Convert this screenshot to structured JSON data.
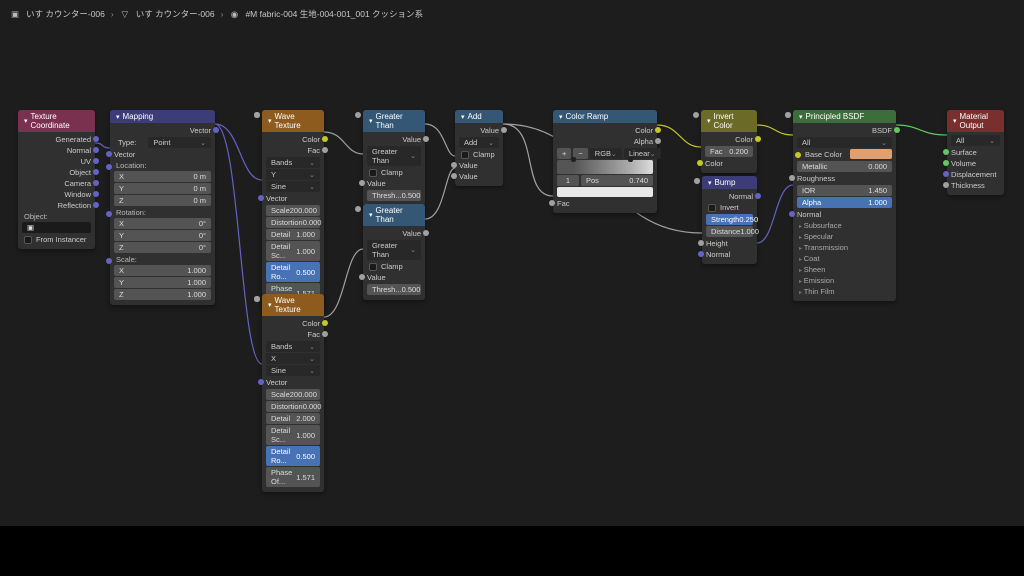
{
  "breadcrumb": {
    "item1": "いす カウンター-006",
    "item2": "いす カウンター-006",
    "item3": "#M fabric-004 生地-004-001_001 クッション系"
  },
  "nodes": {
    "texcoord": {
      "title": "Texture Coordinate",
      "outputs": [
        "Generated",
        "Normal",
        "UV",
        "Object",
        "Camera",
        "Window",
        "Reflection"
      ],
      "obj_label": "Object:",
      "from_instancer": "From Instancer"
    },
    "mapping": {
      "title": "Mapping",
      "out": "Vector",
      "type_label": "Type:",
      "type_value": "Point",
      "vec_in": "Vector",
      "loc_label": "Location:",
      "xyz": [
        "X",
        "Y",
        "Z"
      ],
      "loc_vals": [
        "0 m",
        "0 m",
        "0 m"
      ],
      "rot_label": "Rotation:",
      "rot_vals": [
        "0°",
        "0°",
        "0°"
      ],
      "scale_label": "Scale:",
      "scale_vals": [
        "1.000",
        "1.000",
        "1.000"
      ]
    },
    "wave1": {
      "title": "Wave Texture",
      "out_color": "Color",
      "out_fac": "Fac",
      "bands": "Bands",
      "dir": "Y",
      "profile": "Sine",
      "vec": "Vector",
      "scale": "Scale",
      "scale_v": "200.000",
      "distortion": "Distortion",
      "distortion_v": "0.000",
      "detail": "Detail",
      "detail_v": "1.000",
      "detail_sc": "Detail Sc...",
      "detail_sc_v": "1.000",
      "detail_ro": "Detail Ro...",
      "detail_ro_v": "0.500",
      "phase": "Phase Of...",
      "phase_v": "1.571"
    },
    "wave2": {
      "title": "Wave Texture",
      "out_color": "Color",
      "out_fac": "Fac",
      "bands": "Bands",
      "dir": "X",
      "profile": "Sine",
      "vec": "Vector",
      "scale": "Scale",
      "scale_v": "200.000",
      "distortion": "Distortion",
      "distortion_v": "0.000",
      "detail": "Detail",
      "detail_v": "2.000",
      "detail_sc": "Detail Sc...",
      "detail_sc_v": "1.000",
      "detail_ro": "Detail Ro...",
      "detail_ro_v": "0.500",
      "phase": "Phase Of...",
      "phase_v": "1.571"
    },
    "gt1": {
      "title": "Greater Than",
      "out": "Value",
      "op": "Greater Than",
      "clamp": "Clamp",
      "value": "Value",
      "thresh": "Thresh...",
      "thresh_v": "0.500"
    },
    "gt2": {
      "title": "Greater Than",
      "out": "Value",
      "op": "Greater Than",
      "clamp": "Clamp",
      "value": "Value",
      "thresh": "Thresh...",
      "thresh_v": "0.500"
    },
    "add": {
      "title": "Add",
      "out": "Value",
      "op": "Add",
      "clamp": "Clamp",
      "v1": "Value",
      "v2": "Value"
    },
    "ramp": {
      "title": "Color Ramp",
      "out_color": "Color",
      "out_alpha": "Alpha",
      "mode": "RGB",
      "interp": "Linear",
      "pos": "Pos",
      "idx": "1",
      "pos_v": "0.740",
      "fac": "Fac"
    },
    "invert": {
      "title": "Invert Color",
      "out": "Color",
      "fac": "Fac",
      "fac_v": "0.200",
      "color": "Color"
    },
    "bump": {
      "title": "Bump",
      "invert": "Invert",
      "strength": "Strength",
      "strength_v": "0.250",
      "distance": "Distance",
      "distance_v": "1.000",
      "height": "Height",
      "normal": "Normal"
    },
    "principled": {
      "title": "Principled BSDF",
      "out": "BSDF",
      "dist": "All",
      "basecolor": "Base Color",
      "metallic": "Metallic",
      "metallic_v": "0.000",
      "rough": "Roughness",
      "ior": "IOR",
      "ior_v": "1.450",
      "alpha": "Alpha",
      "alpha_v": "1.000",
      "normal": "Normal",
      "groups": [
        "Subsurface",
        "Specular",
        "Transmission",
        "Coat",
        "Sheen",
        "Emission",
        "Thin Film"
      ]
    },
    "output": {
      "title": "Material Output",
      "target": "All",
      "surface": "Surface",
      "volume": "Volume",
      "disp": "Displacement",
      "thick": "Thickness"
    }
  }
}
